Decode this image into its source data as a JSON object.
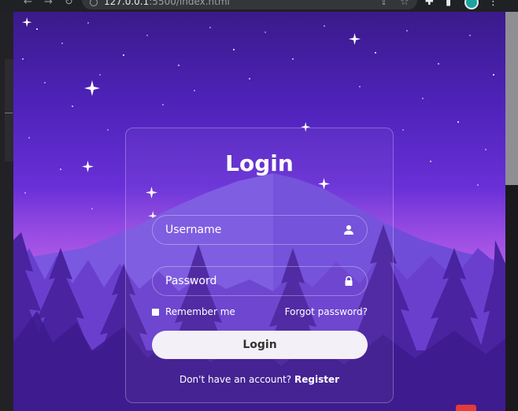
{
  "browser": {
    "url_host": "127.0.0.1",
    "url_rest": ":5500/index.html",
    "back_icon": "back-arrow-icon",
    "forward_icon": "forward-arrow-icon",
    "reload_icon": "reload-icon"
  },
  "login": {
    "title": "Login",
    "username_placeholder": "Username",
    "password_placeholder": "Password",
    "remember_label": "Remember me",
    "forgot_label": "Forgot password?",
    "button_label": "Login",
    "register_prompt": "Don't have an account?",
    "register_link": "Register"
  },
  "colors": {
    "sky_top": "#3a1a8a",
    "sky_glow": "#9a4fe0",
    "mountain": "#7a58e0",
    "trees_far": "#6a3fce",
    "trees_near": "#4a23a0",
    "button_bg": "#f3f0f7"
  }
}
